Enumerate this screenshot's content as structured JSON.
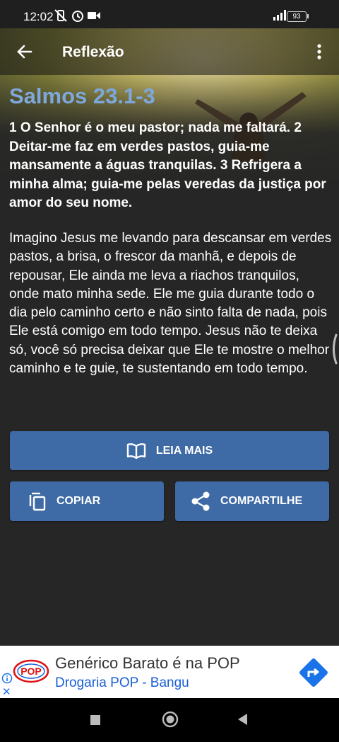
{
  "status_bar": {
    "time": "12:02",
    "battery": "93",
    "icons": [
      "no-vibrate-icon",
      "alarm-icon",
      "video-camera-icon",
      "signal-icon",
      "battery-icon"
    ]
  },
  "app_bar": {
    "title": "Reflexão",
    "back_icon": "arrow-left-icon",
    "menu_icon": "more-vertical-icon"
  },
  "content": {
    "verse_reference": "Salmos 23.1-3",
    "verse_text": "1 O Senhor é o meu pastor; nada me faltará. 2 Deitar-me faz em verdes pastos, guia-me mansamente a águas tranquilas. 3 Refrigera a minha alma; guia-me pelas veredas da justiça por amor do seu nome.",
    "reflection": "Imagino Jesus me levando para descansar em verdes pastos, a brisa, o frescor da manhã, e depois de repousar, Ele ainda me leva a riachos tranquilos, onde mato minha sede. Ele me guia durante todo o dia pelo caminho certo e não sinto falta de nada, pois Ele está comigo em todo tempo. Jesus não te deixa só, você só precisa deixar que Ele te mostre o melhor caminho e te guie, te sustentando em todo tempo."
  },
  "actions": {
    "read_more": "LEIA MAIS",
    "copy": "COPIAR",
    "share": "COMPARTILHE"
  },
  "ad": {
    "title": "Genérico Barato é na POP",
    "subtitle": "Drogaria POP - Bangu",
    "logo_text": "POP",
    "close": "✕"
  },
  "colors": {
    "accent": "#3e6aa5",
    "verse_ref": "#7ea7db",
    "background": "#262626"
  }
}
